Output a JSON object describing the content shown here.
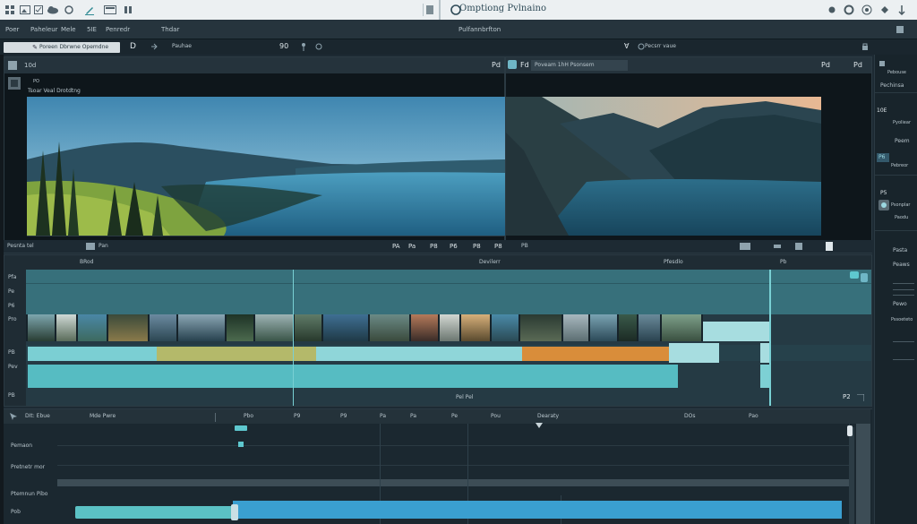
{
  "app": {
    "title": "Omptiong Pvlnaino",
    "accent": "#5ec8cf",
    "clip_color": "#3aa8b0",
    "orange_clip": "#d98d3a"
  },
  "topbar": {
    "icons": [
      "grid-icon",
      "image-icon",
      "checkbox-icon",
      "cloud-icon",
      "sun-icon",
      "pencil-icon",
      "window-icon",
      "pause-icon"
    ],
    "right_icons": [
      "home-icon",
      "settings-icon",
      "upload-icon",
      "help-icon"
    ]
  },
  "menubar": {
    "items": [
      "Poer",
      "Paheleur",
      "Mele",
      "5IE",
      "Penredr",
      "Thdar"
    ],
    "center_label": "Pulfannbrfton",
    "search": {
      "value": "Poreen Dbrwne Opemdne",
      "label2": "Pauhae",
      "label3": "Pecsrr vaue"
    },
    "counter": "90"
  },
  "source_viewer": {
    "tab": "10d",
    "clip_name": "Tsoar Veal Drotdtng",
    "page": "Pd",
    "zoom": "PO",
    "timecode": "Pesnta tel"
  },
  "program_viewer": {
    "tab_label": "Fd",
    "clip_name": "Poveam 1hH Psonsem",
    "page": "Pd",
    "right_label": "Pd"
  },
  "viewer_controls": {
    "left": "Pan",
    "numbers": [
      "PA",
      "Pa",
      "P8",
      "P6",
      "P8",
      "P8"
    ],
    "speed": "PB"
  },
  "timeline_top": {
    "labels": [
      "BRod",
      "Devilerr",
      "Pfesdlo",
      "Pb"
    ],
    "track_labels": [
      "Pfa",
      "Pe",
      "P6",
      "Pro",
      "PB",
      "Pev",
      "PB"
    ],
    "bottom": "Pel Pel",
    "corner": "P2"
  },
  "timeline_bottom": {
    "header": {
      "label": "DIt: Ebue",
      "col1": "Mde Pwre",
      "marks": [
        "Pbo",
        "P9",
        "P9",
        "Pa",
        "Pa",
        "Pe",
        "Pou",
        "Dearaty",
        "DOs",
        "Pao"
      ]
    },
    "tracks": [
      "Pemaon",
      "Pretnetr mor",
      "Ptemnun Pibo",
      "Pob"
    ]
  },
  "right_panel": {
    "labels": [
      "Pebouse",
      "Pechinsa",
      "Pyoliear",
      "Peem",
      "Pebreor",
      "Psonplar",
      "Paodu",
      "Pasta",
      "Peaws",
      "Pewo",
      "Pssoeteto"
    ],
    "badges": [
      "10E",
      "P6",
      "P5",
      "Fv"
    ]
  }
}
